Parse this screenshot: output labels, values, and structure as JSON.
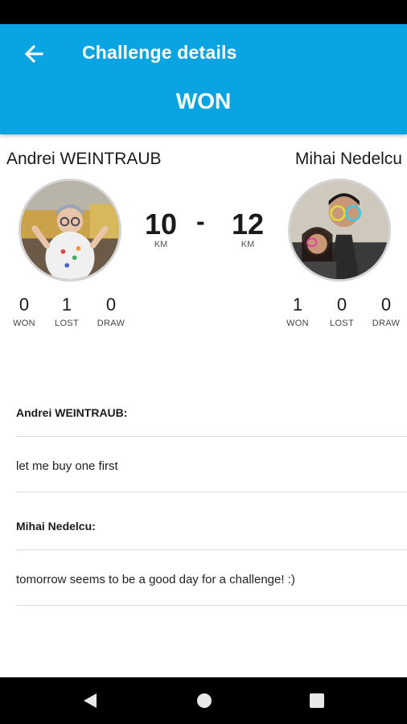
{
  "header": {
    "title": "Challenge details",
    "result": "WON"
  },
  "player1": {
    "name": "Andrei WEINTRAUB",
    "score": "10",
    "unit": "KM",
    "stats": [
      {
        "value": "0",
        "label": "WON"
      },
      {
        "value": "1",
        "label": "LOST"
      },
      {
        "value": "0",
        "label": "DRAW"
      }
    ]
  },
  "player2": {
    "name": "Mihai Nedelcu",
    "score": "12",
    "unit": "KM",
    "stats": [
      {
        "value": "1",
        "label": "WON"
      },
      {
        "value": "0",
        "label": "LOST"
      },
      {
        "value": "0",
        "label": "DRAW"
      }
    ]
  },
  "score_separator": "-",
  "comments": [
    {
      "author": "Andrei WEINTRAUB:",
      "message": "let me buy one first"
    },
    {
      "author": "Mihai Nedelcu:",
      "message": "tomorrow seems to be a good day for a challenge! :)"
    }
  ],
  "colors": {
    "app_bar": "#0aa4e3",
    "text": "#1a1a1a"
  },
  "icons": {
    "back": "arrow-left-icon",
    "nav_back": "triangle-back-icon",
    "nav_home": "circle-home-icon",
    "nav_recent": "square-recent-icon"
  }
}
